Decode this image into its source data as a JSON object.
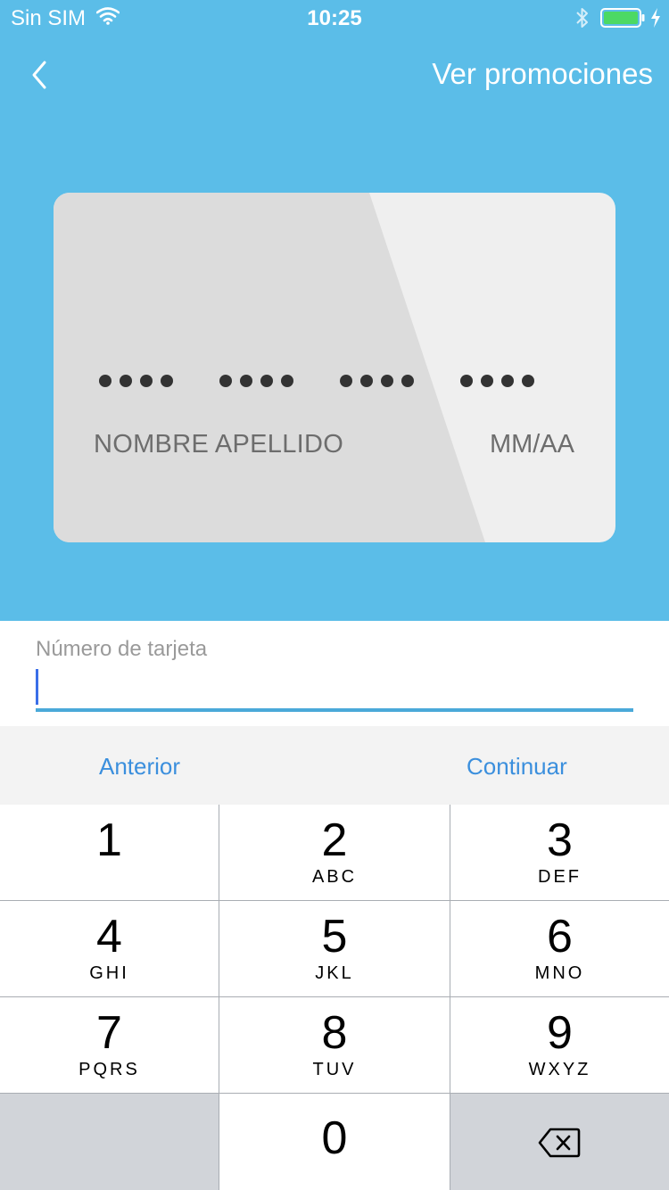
{
  "status_bar": {
    "carrier": "Sin SIM",
    "time": "10:25",
    "battery_color": "#4cd964"
  },
  "nav": {
    "back_icon": "chevron-left-icon",
    "promotions_label": "Ver promociones"
  },
  "card": {
    "number_mask": "•••• •••• •••• ••••",
    "holder_placeholder": "NOMBRE APELLIDO",
    "expiry_placeholder": "MM/AA"
  },
  "form": {
    "card_number_label": "Número de tarjeta",
    "card_number_value": ""
  },
  "accessory": {
    "previous_label": "Anterior",
    "next_label": "Continuar"
  },
  "keypad": {
    "keys": [
      {
        "digit": "1",
        "letters": ""
      },
      {
        "digit": "2",
        "letters": "ABC"
      },
      {
        "digit": "3",
        "letters": "DEF"
      },
      {
        "digit": "4",
        "letters": "GHI"
      },
      {
        "digit": "5",
        "letters": "JKL"
      },
      {
        "digit": "6",
        "letters": "MNO"
      },
      {
        "digit": "7",
        "letters": "PQRS"
      },
      {
        "digit": "8",
        "letters": "TUV"
      },
      {
        "digit": "9",
        "letters": "WXYZ"
      },
      {
        "digit": "0",
        "letters": ""
      }
    ],
    "delete_icon": "backspace-icon"
  },
  "colors": {
    "header_background": "#5bbde8",
    "accent": "#3b8fdd",
    "input_underline": "#4aa9d9"
  }
}
